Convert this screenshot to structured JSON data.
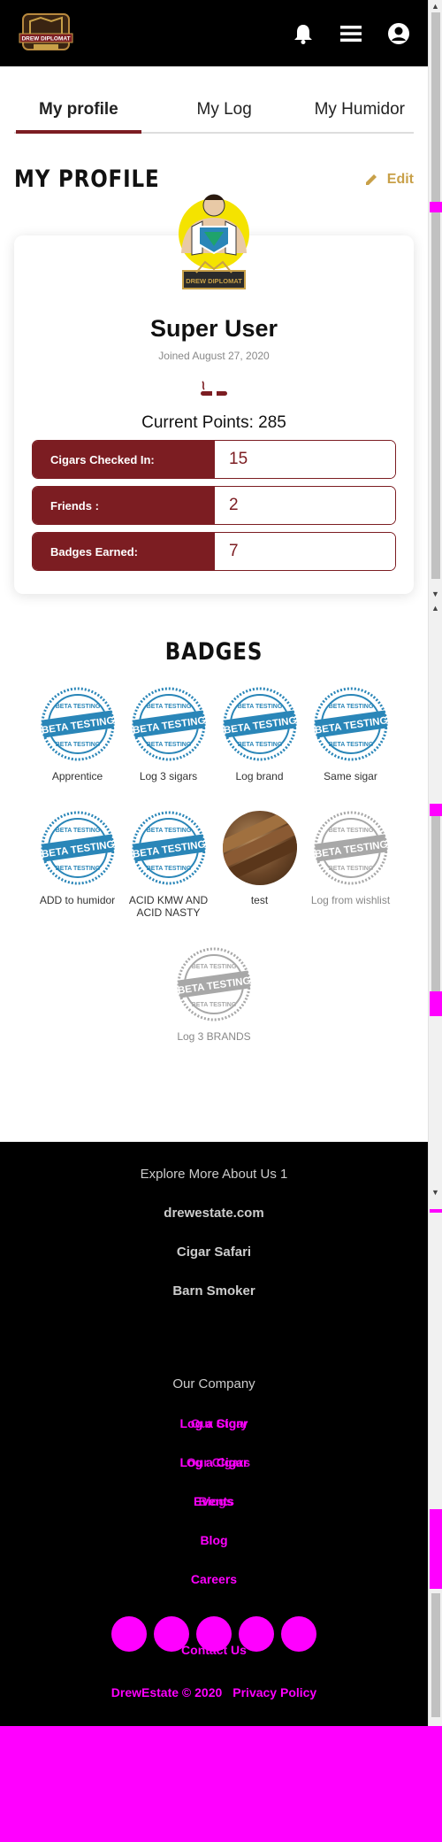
{
  "header": {
    "logo_text": "DREW DIPLOMAT",
    "icons": [
      "bell-icon",
      "menu-icon",
      "user-icon"
    ]
  },
  "tabs": [
    {
      "label": "My profile",
      "active": true
    },
    {
      "label": "My Log",
      "active": false
    },
    {
      "label": "My Humidor",
      "active": false
    }
  ],
  "profile": {
    "section_title": "MY PROFILE",
    "edit_label": "Edit",
    "avatar_text": "DREW DIPLOMAT",
    "name": "Super User",
    "joined": "Joined August 27, 2020",
    "points": "Current Points: 285",
    "stats": [
      {
        "label": "Cigars Checked In:",
        "value": "15"
      },
      {
        "label": "Friends :",
        "value": "2"
      },
      {
        "label": "Badges Earned:",
        "value": "7"
      }
    ]
  },
  "badges": {
    "title": "BADGES",
    "stamp_text": "BETA TESTING",
    "items": [
      {
        "label": "Apprentice",
        "earned": true,
        "kind": "stamp"
      },
      {
        "label": "Log 3 sigars",
        "earned": true,
        "kind": "stamp"
      },
      {
        "label": "Log brand",
        "earned": true,
        "kind": "stamp"
      },
      {
        "label": "Same sigar",
        "earned": true,
        "kind": "stamp"
      },
      {
        "label": "ADD to humidor",
        "earned": true,
        "kind": "stamp"
      },
      {
        "label": "ACID KMW AND ACID NASTY",
        "earned": true,
        "kind": "stamp"
      },
      {
        "label": "test",
        "earned": true,
        "kind": "photo"
      },
      {
        "label": "Log from wishlist",
        "earned": false,
        "kind": "stamp"
      },
      {
        "label": "Log 3 BRANDS",
        "earned": false,
        "kind": "stamp"
      }
    ]
  },
  "footer": {
    "explore_heading": "Explore More About Us 1",
    "explore_links": [
      "drewestate.com",
      "Cigar Safari",
      "Barn Smoker"
    ],
    "company_heading": "Our Company",
    "company_links": [
      "Log a Cigar",
      "Log a Cigar",
      "Events",
      "Blog",
      "Careers",
      "Contact Us"
    ],
    "overlay_links": [
      "Our Story",
      "Our Cigars",
      "Blogs"
    ],
    "copyright": "DrewEstate © 2020",
    "privacy": "Privacy Policy"
  },
  "colors": {
    "accent": "#7c1d22",
    "gold": "#c8a048",
    "badge_blue": "#2a86b8",
    "placeholder": "#ff00ff"
  }
}
